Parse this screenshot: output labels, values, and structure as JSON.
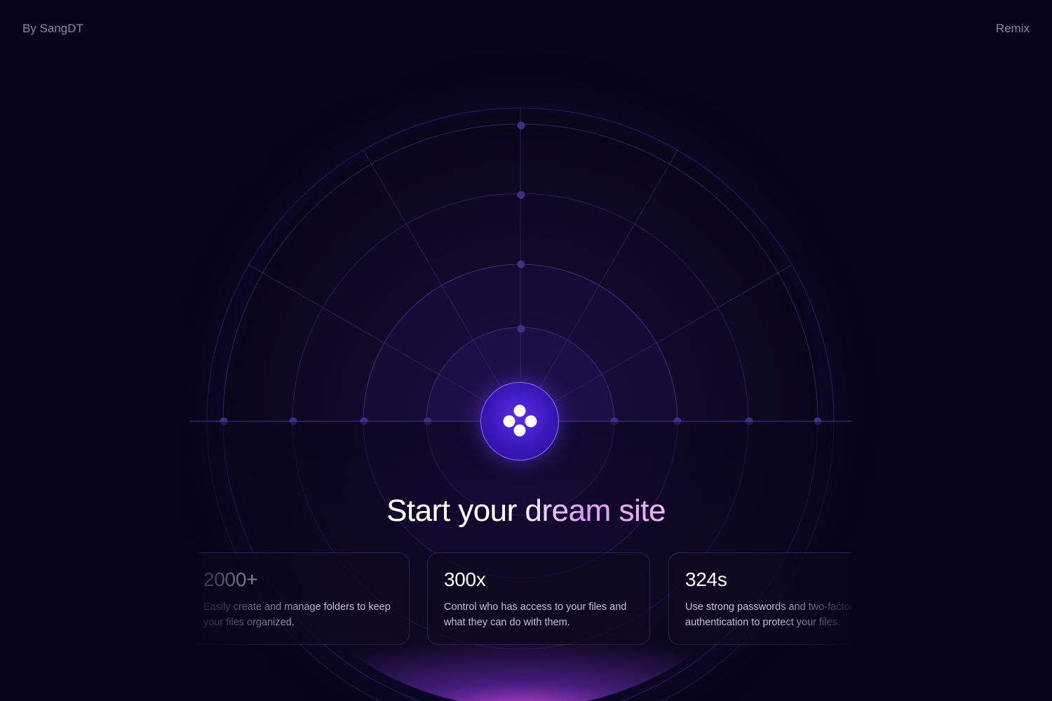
{
  "header": {
    "author": "By SangDT",
    "link": "Remix"
  },
  "hero": {
    "logo_icon": "four-dots-logo-icon",
    "headline": "Start your dream site"
  },
  "stats": [
    {
      "value": "2000+",
      "description": "Easily create and manage folders to keep your files organized."
    },
    {
      "value": "300x",
      "description": "Control who has access to your files and what they can do with them."
    },
    {
      "value": "324s",
      "description": "Use strong passwords and two-factor authentication to protect your files."
    }
  ],
  "colors": {
    "background": "#07051a",
    "accent": "#5a2ee8",
    "glow": "#c846e6"
  }
}
